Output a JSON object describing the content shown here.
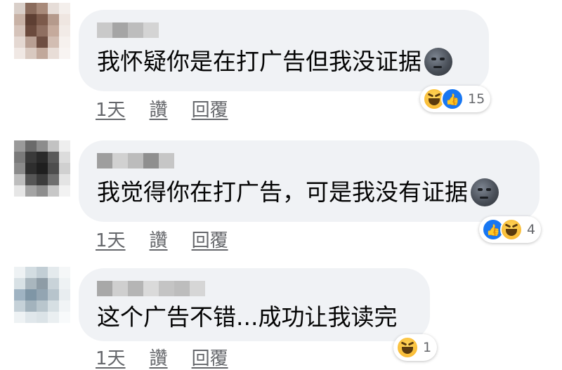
{
  "comments": [
    {
      "text": "我怀疑你是在打广告但我没证据",
      "has_emoji": true,
      "actions": {
        "time": "1天",
        "like": "讚",
        "reply": "回覆"
      },
      "reactions": {
        "icons": [
          "haha-icon",
          "like-icon"
        ],
        "count": "15"
      }
    },
    {
      "text": "我觉得你在打广告，可是我没有证据",
      "has_emoji": true,
      "actions": {
        "time": "1天",
        "like": "讚",
        "reply": "回覆"
      },
      "reactions": {
        "icons": [
          "like-icon",
          "haha-icon"
        ],
        "count": "4"
      }
    },
    {
      "text": "这个广告不错...成功让我读完",
      "has_emoji": false,
      "actions": {
        "time": "1天",
        "like": "讚",
        "reply": "回覆"
      },
      "reactions": {
        "icons": [
          "haha-icon"
        ],
        "count": "1"
      }
    }
  ],
  "colors": {
    "bubble": "#f0f2f5",
    "text": "#050505",
    "meta": "#65676b",
    "like_blue": "#1877f2",
    "haha_yellow": "#f7b125"
  }
}
